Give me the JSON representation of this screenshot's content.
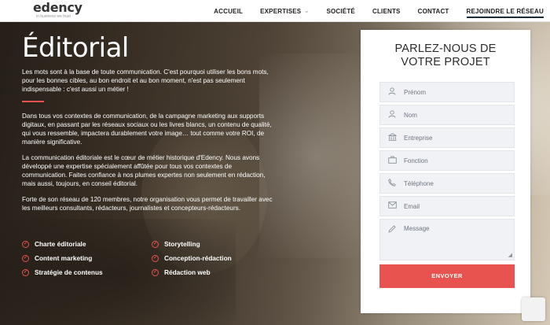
{
  "brand": {
    "name": "edency",
    "tagline": "in business we trust"
  },
  "nav": {
    "items": [
      {
        "label": "ACCUEIL"
      },
      {
        "label": "EXPERTISES",
        "has_dropdown": true
      },
      {
        "label": "SOCIÉTÉ"
      },
      {
        "label": "CLIENTS"
      },
      {
        "label": "CONTACT"
      },
      {
        "label": "REJOINDRE LE RÉSEAU",
        "active": true
      }
    ]
  },
  "hero": {
    "title": "Éditorial",
    "intro": "Les mots sont à la base de toute communication. C'est pourquoi utiliser les bons mots, pour les bonnes cibles, au bon endroit et au bon moment, n'est pas seulement indispensable : c'est aussi un métier !",
    "paragraphs": [
      "Dans tous vos contextes de communication, de la campagne marketing aux supports digitaux, en passant par les réseaux sociaux ou les livres blancs, un contenu de qualité, qui vous ressemble, impactera durablement votre image… tout comme votre ROI, de manière significative.",
      "La communication éditoriale est le cœur de métier historique d'Edency. Nous avons développé une expertise spécialement affûtée pour tous vos contextes de communication. Faites confiance à nos plumes expertes non seulement en rédaction, mais aussi, toujours, en conseil éditorial.",
      "Forte de son réseau de 120 membres, notre organisation vous permet de travailler avec les meilleurs consultants, rédacteurs, journalistes et concepteurs-rédacteurs."
    ],
    "services": [
      "Charte éditoriale",
      "Storytelling",
      "Content marketing",
      "Conception-rédaction",
      "Stratégie de contenus",
      "Rédaction web"
    ]
  },
  "form": {
    "title_line1": "PARLEZ-NOUS DE",
    "title_line2": "VOTRE PROJET",
    "fields": [
      {
        "placeholder": "Prénom",
        "icon": "user-icon"
      },
      {
        "placeholder": "Nom",
        "icon": "user-icon"
      },
      {
        "placeholder": "Entreprise",
        "icon": "building-icon"
      },
      {
        "placeholder": "Fonction",
        "icon": "briefcase-icon"
      },
      {
        "placeholder": "Téléphone",
        "icon": "phone-icon"
      },
      {
        "placeholder": "Email",
        "icon": "envelope-icon"
      },
      {
        "placeholder": "Message",
        "icon": "pencil-icon"
      }
    ],
    "submit_label": "ENVOYER"
  },
  "colors": {
    "accent": "#e9534f",
    "nav_text": "#222222",
    "form_title": "#2c2c2c"
  }
}
